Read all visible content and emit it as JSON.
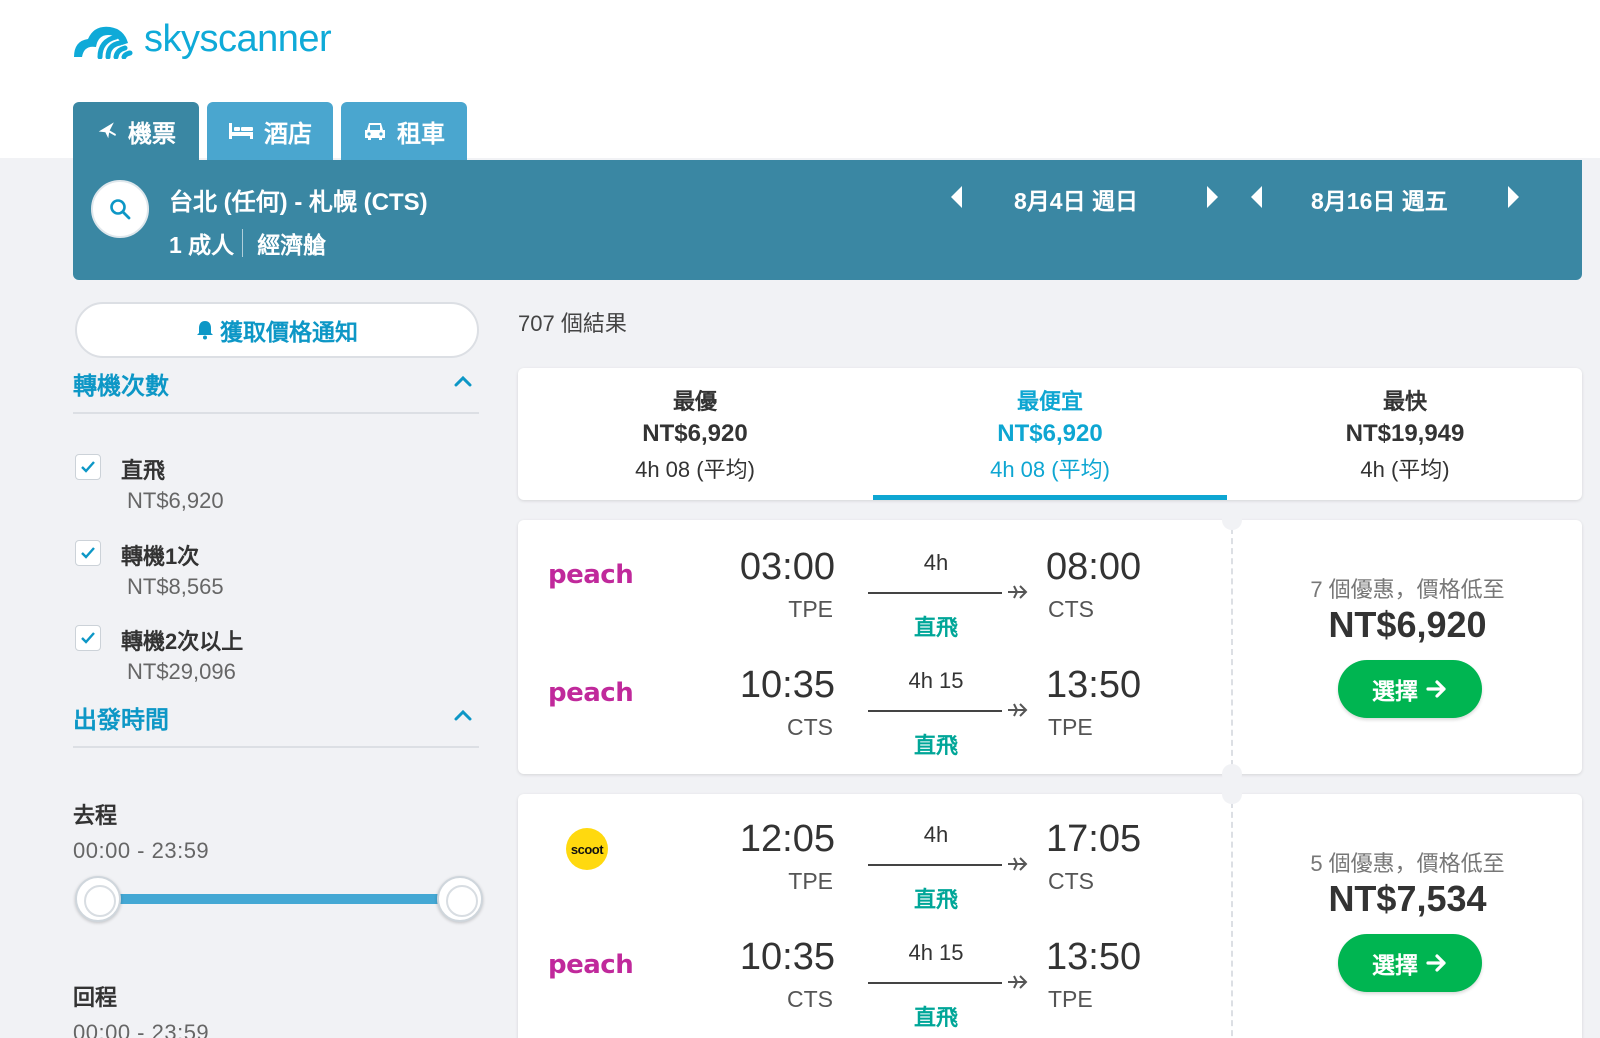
{
  "brand": {
    "name": "skyscanner"
  },
  "tabs": [
    {
      "label": "機票",
      "icon": "plane-icon"
    },
    {
      "label": "酒店",
      "icon": "bed-icon"
    },
    {
      "label": "租車",
      "icon": "car-icon"
    }
  ],
  "search": {
    "route": "台北 (任何) - 札幌 (CTS)",
    "passengers": "1 成人",
    "cabin": "經濟艙",
    "depart_date": "8月4日 週日",
    "return_date": "8月16日 週五"
  },
  "sidebar": {
    "alert_label": "獲取價格通知",
    "stops_title": "轉機次數",
    "stops": [
      {
        "label": "直飛",
        "price": "NT$6,920",
        "checked": true
      },
      {
        "label": "轉機1次",
        "price": "NT$8,565",
        "checked": true
      },
      {
        "label": "轉機2次以上",
        "price": "NT$29,096",
        "checked": true
      }
    ],
    "times_title": "出發時間",
    "outbound_label": "去程",
    "outbound_range": "00:00 - 23:59",
    "return_label": "回程",
    "return_range": "00:00 - 23:59"
  },
  "results": {
    "count_text": "707 個結果",
    "sort": [
      {
        "title": "最優",
        "price": "NT$6,920",
        "duration": "4h 08 (平均)",
        "selected": false
      },
      {
        "title": "最便宜",
        "price": "NT$6,920",
        "duration": "4h 08 (平均)",
        "selected": true
      },
      {
        "title": "最快",
        "price": "NT$19,949",
        "duration": "4h (平均)",
        "selected": false
      }
    ],
    "cards": [
      {
        "legs": [
          {
            "airline": "peach",
            "dep_time": "03:00",
            "dep_code": "TPE",
            "duration": "4h",
            "stops": "直飛",
            "arr_time": "08:00",
            "arr_code": "CTS"
          },
          {
            "airline": "peach",
            "dep_time": "10:35",
            "dep_code": "CTS",
            "duration": "4h 15",
            "stops": "直飛",
            "arr_time": "13:50",
            "arr_code": "TPE"
          }
        ],
        "deals": "7 個優惠，價格低至",
        "price": "NT$6,920",
        "button": "選擇"
      },
      {
        "legs": [
          {
            "airline": "scoot",
            "dep_time": "12:05",
            "dep_code": "TPE",
            "duration": "4h",
            "stops": "直飛",
            "arr_time": "17:05",
            "arr_code": "CTS"
          },
          {
            "airline": "peach",
            "dep_time": "10:35",
            "dep_code": "CTS",
            "duration": "4h 15",
            "stops": "直飛",
            "arr_time": "13:50",
            "arr_code": "TPE"
          }
        ],
        "deals": "5 個優惠，價格低至",
        "price": "NT$7,534",
        "button": "選擇"
      }
    ]
  },
  "colors": {
    "brand_blue": "#0faad8",
    "search_bar": "#3a87a3",
    "tab_inactive": "#4aa6cf",
    "accent": "#0ea6d2",
    "direct_green": "#00a698",
    "select_green": "#00b551",
    "peach_magenta": "#c0299b",
    "scoot_yellow": "#ffd90f"
  }
}
